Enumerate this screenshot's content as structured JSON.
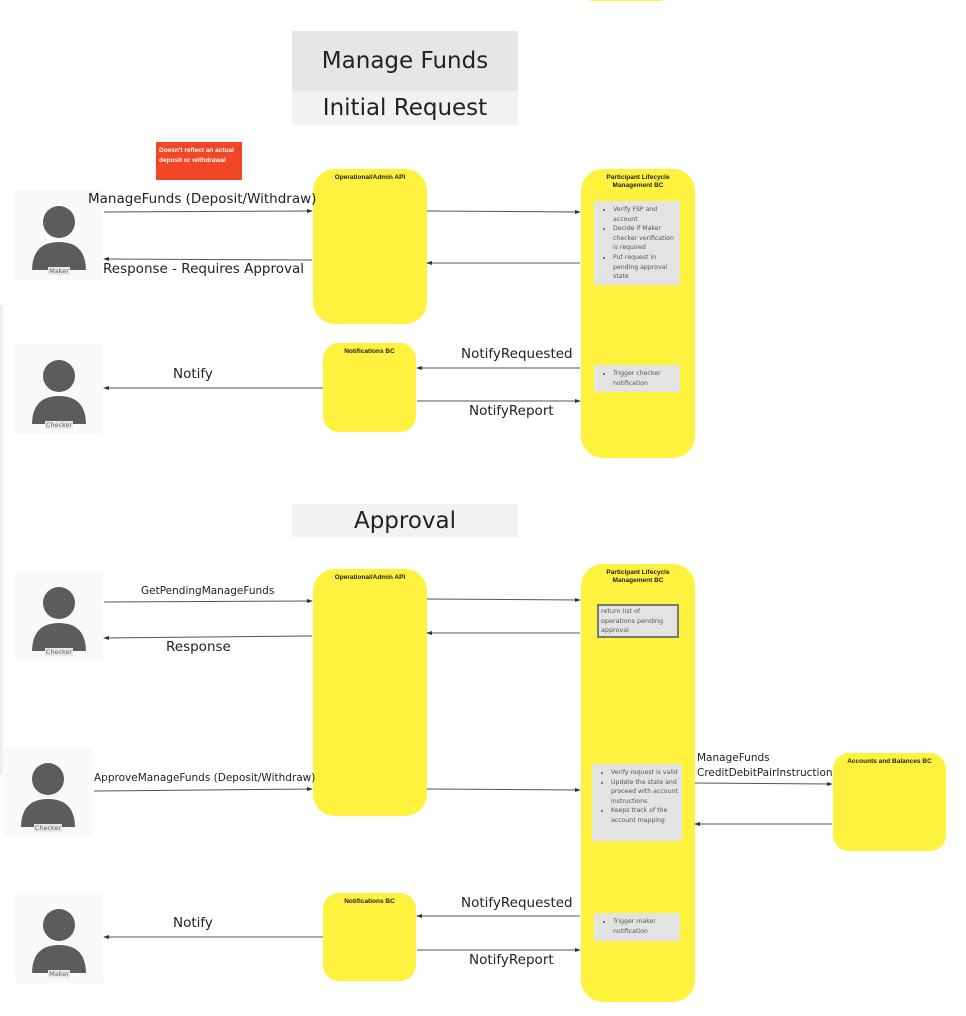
{
  "diagram": {
    "title": "Manage Funds",
    "sections": [
      {
        "id": "initial",
        "title": "Initial Request"
      },
      {
        "id": "approval",
        "title": "Approval"
      }
    ],
    "sticky_note": "Doesn't reflect an actual deposit or withdrawal",
    "colors": {
      "component_fill": "#fff23f",
      "sticky_fill": "#f24726",
      "note_fill": "#e3e3e3",
      "actor_fill": "#5c5c5c"
    },
    "initial": {
      "actors": {
        "maker": "Maker",
        "checker": "Checker"
      },
      "components": {
        "admin_api": "Operational/Admin API",
        "plm": "Participant Lifecycle Management BC",
        "notifications": "Notifications BC"
      },
      "notes": {
        "plm_steps": [
          "Verify FSP and account",
          "Decide if Maker checker verification is required",
          "Put request in pending approval state"
        ],
        "plm_notify": [
          "Trigger checker notification"
        ]
      },
      "messages": {
        "manage_funds": "ManageFunds (Deposit/Withdraw)",
        "response": "Response - Requires Approval",
        "notify": "Notify",
        "notify_requested": "NotifyRequested",
        "notify_report": "NotifyReport"
      }
    },
    "approval": {
      "actors": {
        "checker_1": "Checker",
        "checker_2": "Checker",
        "maker": "Maker"
      },
      "components": {
        "admin_api": "Operational/Admin API",
        "plm": "Participant Lifecycle Management BC",
        "notifications": "Notifications BC",
        "accounts": "Accounts and Balances BC"
      },
      "notes": {
        "pending_list": "return list of operations pending approval",
        "plm_steps": [
          "Verify request is valid",
          "Update the state and proceed with account instructions",
          "Keeps track of the account mapping"
        ],
        "plm_notify": [
          "Trigger maker notification"
        ]
      },
      "messages": {
        "get_pending": "GetPendingManageFunds",
        "response": "Response",
        "approve": "ApproveManageFunds (Deposit/Withdraw)",
        "credit_debit_line1": "ManageFunds",
        "credit_debit_line2": "CreditDebitPairInstruction",
        "notify": "Notify",
        "notify_requested": "NotifyRequested",
        "notify_report": "NotifyReport"
      }
    }
  }
}
